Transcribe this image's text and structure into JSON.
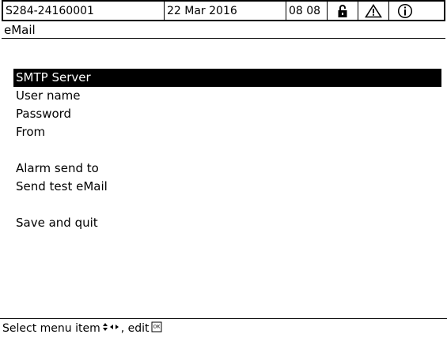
{
  "status": {
    "device_id": "S284-24160001",
    "date": "22 Mar  2016",
    "time": "08 08",
    "icons": [
      "lock-icon",
      "warning-icon",
      "info-icon"
    ]
  },
  "title": "eMail",
  "menu": {
    "items": [
      {
        "label": "SMTP Server",
        "selected": true
      },
      {
        "label": "User name",
        "selected": false
      },
      {
        "label": "Password",
        "selected": false
      },
      {
        "label": "From",
        "selected": false
      },
      {
        "label": "Alarm send to",
        "selected": false
      },
      {
        "label": "Send test eMail",
        "selected": false
      },
      {
        "label": "Save and quit",
        "selected": false
      }
    ]
  },
  "hint": {
    "select_text": "Select menu item",
    "edit_text": ", edit",
    "edit_key_label": "OK"
  },
  "colors": {
    "selected_bg": "#000000",
    "selected_fg": "#ffffff"
  }
}
